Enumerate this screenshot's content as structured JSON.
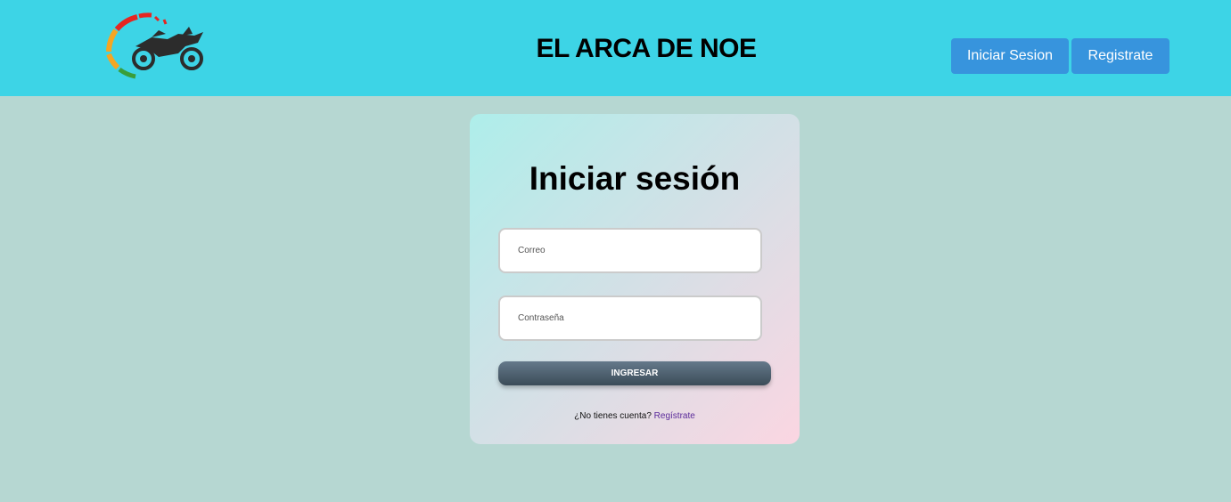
{
  "header": {
    "logo_icon": "motorcycle-speedometer-logo",
    "title": "EL ARCA DE NOE",
    "nav": {
      "login_label": "Iniciar Sesion",
      "register_label": "Registrate"
    }
  },
  "login": {
    "title": "Iniciar sesión",
    "email_placeholder": "Correo",
    "password_placeholder": "Contraseña",
    "submit_label": "INGRESAR",
    "signup_prompt": "¿No tienes cuenta?",
    "signup_link": "Regístrate"
  },
  "colors": {
    "header_bg": "#3dd4e6",
    "page_bg": "#b6d7d2",
    "nav_button": "#3794dd",
    "submit_button": "#4a5c6a",
    "link": "#5a2a9a"
  }
}
